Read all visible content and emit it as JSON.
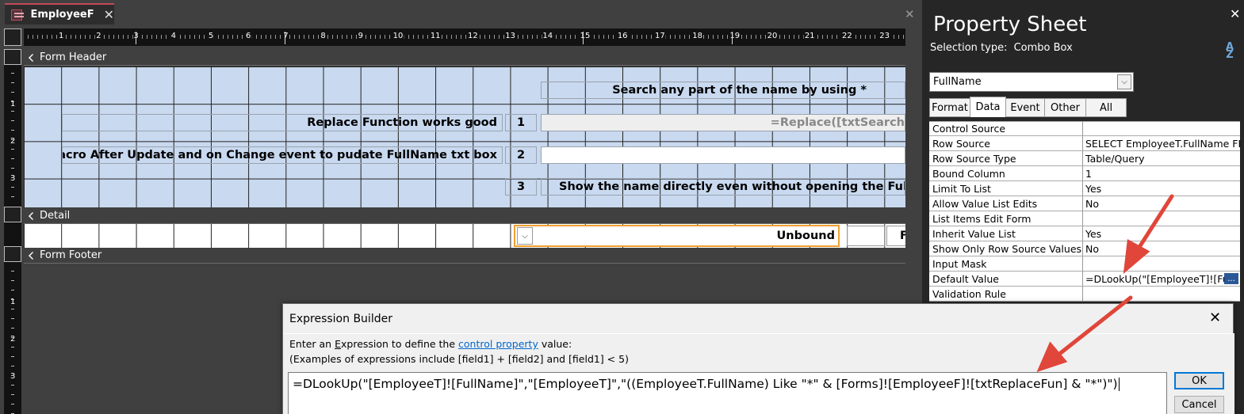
{
  "document": {
    "tab_label": "EmployeeF",
    "tab_close": "✕",
    "close_glyph": "✕"
  },
  "ruler": {
    "numbers": [
      "1",
      "2",
      "3",
      "4",
      "5",
      "6",
      "7",
      "8",
      "9",
      "10",
      "11",
      "12",
      "13",
      "14",
      "15",
      "16",
      "17",
      "18",
      "19",
      "20",
      "21",
      "22",
      "23"
    ],
    "vertical_header": [
      "1",
      "2",
      "3"
    ],
    "vertical_footer": [
      "1",
      "2",
      "3"
    ]
  },
  "sections": {
    "header": "Form Header",
    "detail": "Detail",
    "footer": "Form Footer"
  },
  "header_controls": {
    "search_hint": "Search any part of the name by using *",
    "replace_label": "Replace Function works good",
    "num1": "1",
    "replace_expr": "=Replace([txtSearch",
    "macro_label": "Macro After Update and on Change event to pudate FullName txt box",
    "num2": "2",
    "num3": "3",
    "show_name_label": "Show the name directly even without opening the FullNam"
  },
  "detail_controls": {
    "combo_value": "Unbound",
    "right_label": "F"
  },
  "property_sheet": {
    "title": "Property Sheet",
    "close_glyph": "✕",
    "selection_type_label": "Selection type:",
    "selection_type_value": "Combo Box",
    "sort_icon_top": "A",
    "sort_icon_bottom": "Z",
    "object_selected": "FullName",
    "tabs": [
      {
        "label": "Format",
        "active": false
      },
      {
        "label": "Data",
        "active": true
      },
      {
        "label": "Event",
        "active": false
      },
      {
        "label": "Other",
        "active": false
      },
      {
        "label": "All",
        "active": false
      }
    ],
    "rows": [
      {
        "name": "Control Source",
        "value": ""
      },
      {
        "name": "Row Source",
        "value": "SELECT EmployeeT.FullName FRO"
      },
      {
        "name": "Row Source Type",
        "value": "Table/Query"
      },
      {
        "name": "Bound Column",
        "value": "1"
      },
      {
        "name": "Limit To List",
        "value": "Yes"
      },
      {
        "name": "Allow Value List Edits",
        "value": "No"
      },
      {
        "name": "List Items Edit Form",
        "value": ""
      },
      {
        "name": "Inherit Value List",
        "value": "Yes"
      },
      {
        "name": "Show Only Row Source Values",
        "value": "No"
      },
      {
        "name": "Input Mask",
        "value": ""
      },
      {
        "name": "Default Value",
        "value": "=DLookUp(\"[EmployeeT]![Full"
      },
      {
        "name": "Validation Rule",
        "value": ""
      }
    ],
    "ellipsis": "..."
  },
  "expression_builder": {
    "title": "Expression Builder",
    "close_glyph": "✕",
    "instruction_prefix": "Enter an ",
    "instruction_underlined": "E",
    "instruction_middle": "xpression to define the ",
    "instruction_link": "control property",
    "instruction_suffix": " value:",
    "examples": "(Examples of expressions include [field1] + [field2] and [field1] < 5)",
    "expression": "=DLookUp(\"[EmployeeT]![FullName]\",\"[EmployeeT]\",\"((EmployeeT.FullName) Like \"*\" & [Forms]![EmployeeF]![txtReplaceFun] & \"*\")\")",
    "ok_label": "OK",
    "cancel_label": "Cancel"
  },
  "colors": {
    "header_grid": "#c9d9ef",
    "accent_orange": "#f0a030",
    "arrow_red": "#e0463a",
    "link_blue": "#0066cc"
  }
}
